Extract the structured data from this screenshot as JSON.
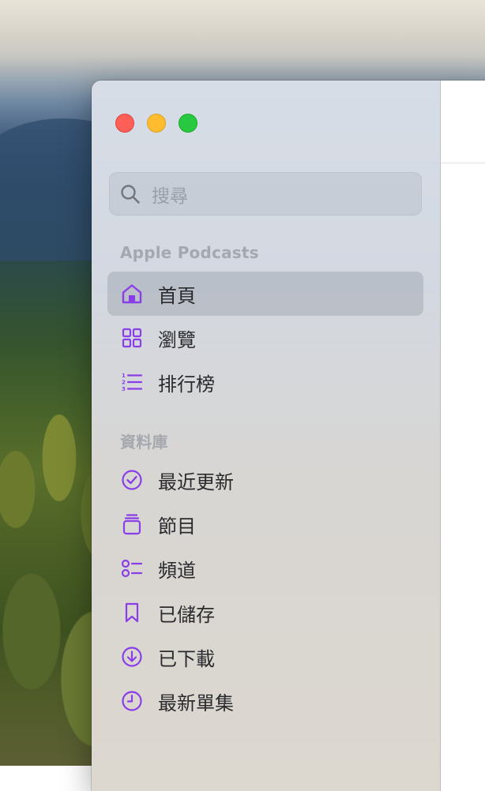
{
  "colors": {
    "accent": "#8a3ee8",
    "traffic_close": "#fe5f57",
    "traffic_minimize": "#febc2e",
    "traffic_maximize": "#28c840"
  },
  "search": {
    "placeholder": "搜尋",
    "icon": "magnifying-glass-icon"
  },
  "sections": {
    "apple_podcasts": {
      "title": "Apple Podcasts",
      "items": [
        {
          "label": "首頁",
          "icon": "house-icon",
          "selected": true
        },
        {
          "label": "瀏覽",
          "icon": "grid-icon",
          "selected": false
        },
        {
          "label": "排行榜",
          "icon": "numbered-list-icon",
          "selected": false
        }
      ]
    },
    "library": {
      "title": "資料庫",
      "items": [
        {
          "label": "最近更新",
          "icon": "checkmark-circle-icon"
        },
        {
          "label": "節目",
          "icon": "stack-icon"
        },
        {
          "label": "頻道",
          "icon": "channels-list-icon"
        },
        {
          "label": "已儲存",
          "icon": "bookmark-icon"
        },
        {
          "label": "已下載",
          "icon": "download-circle-icon"
        },
        {
          "label": "最新單集",
          "icon": "clock-icon"
        }
      ]
    }
  }
}
